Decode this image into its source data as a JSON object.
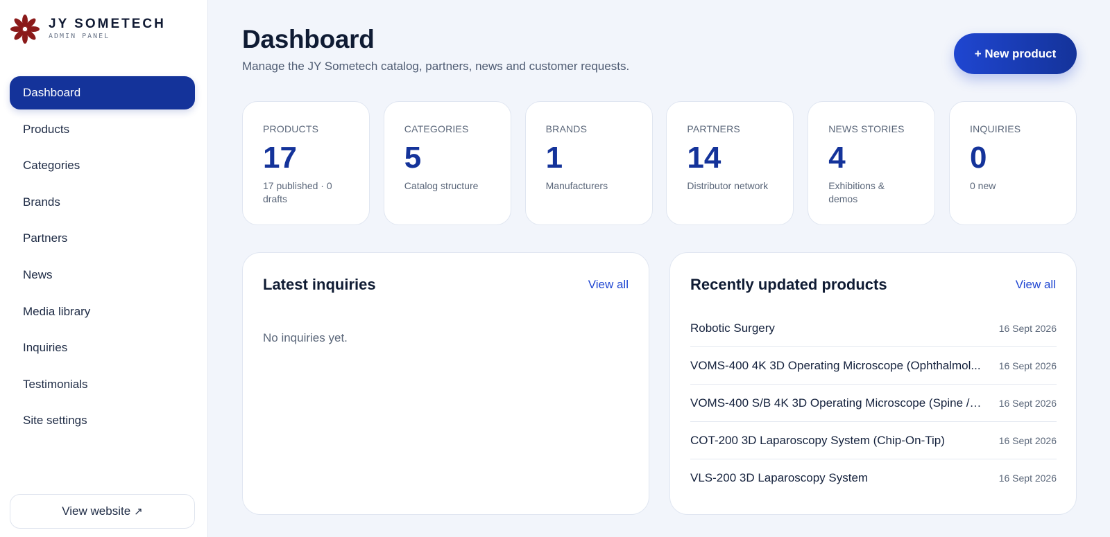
{
  "brand": {
    "name": "JY SOMETECH",
    "subtitle": "ADMIN PANEL",
    "logo_color": "#8b1a1a"
  },
  "sidebar": {
    "items": [
      {
        "label": "Dashboard",
        "active": true
      },
      {
        "label": "Products"
      },
      {
        "label": "Categories"
      },
      {
        "label": "Brands"
      },
      {
        "label": "Partners"
      },
      {
        "label": "News"
      },
      {
        "label": "Media library"
      },
      {
        "label": "Inquiries"
      },
      {
        "label": "Testimonials"
      },
      {
        "label": "Site settings"
      }
    ],
    "view_website": "View website",
    "view_website_icon": "arrow-up-right-icon"
  },
  "header": {
    "title": "Dashboard",
    "subtitle": "Manage the JY Sometech catalog, partners, news and customer requests.",
    "new_button": "+ New product"
  },
  "stats": [
    {
      "label": "PRODUCTS",
      "value": "17",
      "caption": "17 published · 0 drafts"
    },
    {
      "label": "CATEGORIES",
      "value": "5",
      "caption": "Catalog structure"
    },
    {
      "label": "BRANDS",
      "value": "1",
      "caption": "Manufacturers"
    },
    {
      "label": "PARTNERS",
      "value": "14",
      "caption": "Distributor network"
    },
    {
      "label": "NEWS STORIES",
      "value": "4",
      "caption": "Exhibitions & demos"
    },
    {
      "label": "INQUIRIES",
      "value": "0",
      "caption": "0 new"
    }
  ],
  "inquiries": {
    "title": "Latest inquiries",
    "view_all": "View all",
    "empty": "No inquiries yet."
  },
  "recent_products": {
    "title": "Recently updated products",
    "view_all": "View all",
    "items": [
      {
        "name": "Robotic Surgery",
        "date": "16 Sept 2026"
      },
      {
        "name": "VOMS-400 4K 3D Operating Microscope (Ophthalmol...",
        "date": "16 Sept 2026"
      },
      {
        "name": "VOMS-400 S/B 4K 3D Operating Microscope (Spine / ...",
        "date": "16 Sept 2026"
      },
      {
        "name": "COT-200 3D Laparoscopy System (Chip-On-Tip)",
        "date": "16 Sept 2026"
      },
      {
        "name": "VLS-200 3D Laparoscopy System",
        "date": "16 Sept 2026"
      }
    ]
  },
  "colors": {
    "primary": "#14339a",
    "accent": "#1f46d1",
    "background": "#f2f5fb"
  }
}
